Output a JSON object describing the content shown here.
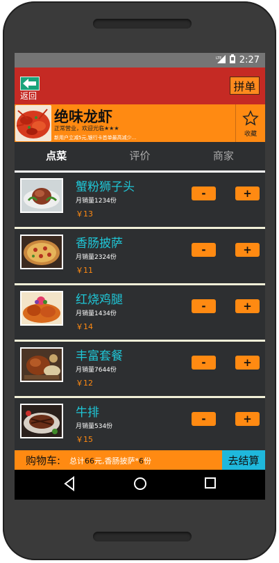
{
  "status_bar": {
    "network": "LTE",
    "time": "2:27"
  },
  "header": {
    "back_label": "返回",
    "group_button": "拼单"
  },
  "shop": {
    "name": "绝味龙虾",
    "status": "正常营业，欢迎光临★★★",
    "promo": "新用户立减5元,银行卡首单最高减少...",
    "favorite_label": "收藏"
  },
  "tabs": [
    {
      "label": "点菜",
      "active": true
    },
    {
      "label": "评价",
      "active": false
    },
    {
      "label": "商家",
      "active": false
    }
  ],
  "dishes": [
    {
      "name": "蟹粉狮子头",
      "sales": "月销量1234份",
      "price": "￥13",
      "image": "meatball-dish",
      "minus": "-",
      "plus": "+"
    },
    {
      "name": "香肠披萨",
      "sales": "月销量2324份",
      "price": "￥11",
      "image": "pizza-dish",
      "minus": "-",
      "plus": "+"
    },
    {
      "name": "红烧鸡腿",
      "sales": "月销量1434份",
      "price": "￥14",
      "image": "chicken-leg-dish",
      "minus": "-",
      "plus": "+"
    },
    {
      "name": "丰富套餐",
      "sales": "月销量7644份",
      "price": "￥12",
      "image": "roast-set-dish",
      "minus": "-",
      "plus": "+"
    },
    {
      "name": "牛排",
      "sales": "月销量534份",
      "price": "￥15",
      "image": "steak-dish",
      "minus": "-",
      "plus": "+"
    }
  ],
  "cart": {
    "label": "购物车:",
    "summary_prefix": "总计",
    "total": "66",
    "summary_mid": "元,香肠披萨*",
    "count": "6",
    "summary_suffix": "份",
    "checkout": "去结算"
  },
  "colors": {
    "header": "#c52a24",
    "accent": "#ff8a12",
    "dish_name": "#1fc6d6",
    "checkout": "#1fb8dc",
    "background": "#2d2f31"
  }
}
